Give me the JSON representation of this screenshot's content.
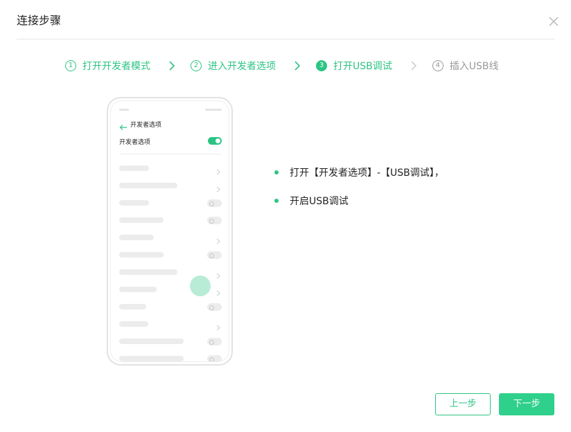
{
  "dialog": {
    "title": "连接步骤",
    "close_icon": "close-icon"
  },
  "steps": [
    {
      "num": "1",
      "label": "打开开发者模式",
      "state": "done"
    },
    {
      "num": "2",
      "label": "进入开发者选项",
      "state": "done"
    },
    {
      "num": "3",
      "label": "打开USB调试",
      "state": "active"
    },
    {
      "num": "4",
      "label": "插入USB线",
      "state": "pending"
    }
  ],
  "phone": {
    "header_title": "开发者选项",
    "first_row_label": "开发者选项",
    "first_row_toggle": "on"
  },
  "instructions": [
    "打开【开发者选项】-【USB调试】，",
    "开启USB调试"
  ],
  "buttons": {
    "prev": "上一步",
    "next": "下一步"
  },
  "colors": {
    "accent": "#2cc483",
    "pending": "#999999",
    "next_button": "#2fd08b"
  }
}
